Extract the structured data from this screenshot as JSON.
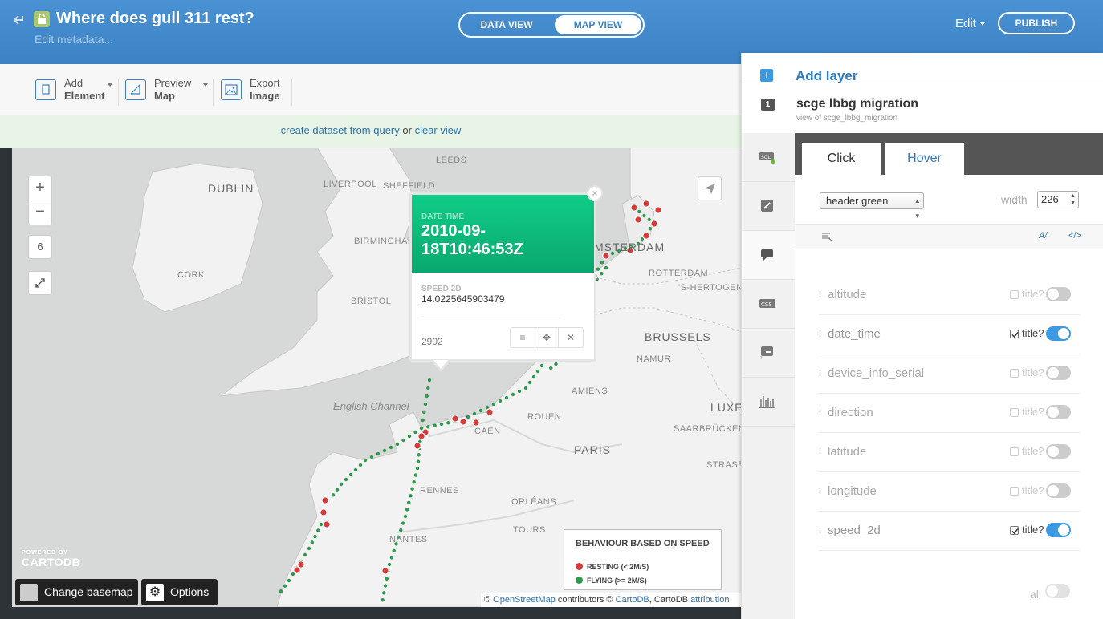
{
  "header": {
    "title": "Where does gull 311 rest?",
    "edit_metadata": "Edit metadata...",
    "view_toggle": {
      "data_view": "DATA VIEW",
      "map_view": "MAP VIEW",
      "active": "map_view"
    },
    "edit_menu": "Edit",
    "publish": "PUBLISH"
  },
  "toolbar": {
    "add_element": {
      "line1": "Add",
      "line2": "Element"
    },
    "preview_map": {
      "line1": "Preview",
      "line2": "Map"
    },
    "export_image": {
      "line1": "Export",
      "line2": "Image"
    }
  },
  "notice": {
    "link1": "create dataset from query",
    "middle": " or ",
    "link2": "clear view"
  },
  "map": {
    "zoom_level": "6",
    "zoom_in": "+",
    "zoom_out": "−",
    "cities": {
      "dublin": "DUBLIN",
      "leeds": "LEEDS",
      "liverpool": "LIVERPOOL",
      "sheffield": "SHEFFIELD",
      "birmingham": "BIRMINGHAM",
      "cork": "CORK",
      "bristol": "BRISTOL",
      "amsterdam": "MSTERDAM",
      "rotterdam": "ROTTERDAM",
      "hertogenbosch": "'S-HERTOGENBOSCH",
      "brussels": "BRUSSELS",
      "namur": "NAMUR",
      "amiens": "AMIENS",
      "luxembourg": "LUXE",
      "rouen": "ROUEN",
      "caen": "CAEN",
      "saarbrucken": "SAARBRÜCKEN",
      "paris": "PARIS",
      "rennes": "RENNES",
      "orleans": "ORLÉANS",
      "strasbourg": "STRASBO",
      "tours": "TOURS",
      "nantes": "NANTES"
    },
    "sea_label": "English Channel",
    "powered_by": "POWERED BY",
    "logo": "CARTODB",
    "change_basemap": "Change basemap",
    "options": "Options",
    "legend": {
      "title": "BEHAVIOUR BASED ON SPEED",
      "items": [
        {
          "label": "RESTING (< 2M/S)",
          "color": "#d43b3b"
        },
        {
          "label": "FLYING (>= 2M/S)",
          "color": "#2e9a4e"
        }
      ]
    },
    "attribution": {
      "c1": "© ",
      "osm": "OpenStreetMap",
      "c2": " contributors © ",
      "cartodb": "CartoDB",
      "c3": ", CartoDB ",
      "attr": "attribution"
    },
    "popup": {
      "date_label": "DATE TIME",
      "date_value": "2010-09-18T10:46:53Z",
      "speed_label": "SPEED 2D",
      "speed_value": "14.0225645903479",
      "id": "2902"
    }
  },
  "panel": {
    "add_layer": "Add layer",
    "layer_number": "1",
    "layer_name": "scge lbbg migration",
    "layer_sub": "view of scge_lbbg_migration",
    "side_icons": [
      "sql-icon",
      "wizard-icon",
      "infowindow-icon",
      "css-icon",
      "legend-icon",
      "chart-icon"
    ],
    "tabs": {
      "click": "Click",
      "hover": "Hover",
      "active": "click"
    },
    "template_select": "header green",
    "width_label": "width",
    "width_value": "226",
    "edit_text_icon": "A/",
    "code_icon": "</>",
    "title_label": "title?",
    "fields": [
      {
        "name": "altitude",
        "title_checked": false,
        "enabled": false
      },
      {
        "name": "date_time",
        "title_checked": true,
        "enabled": true
      },
      {
        "name": "device_info_serial",
        "title_checked": false,
        "enabled": false
      },
      {
        "name": "direction",
        "title_checked": false,
        "enabled": false
      },
      {
        "name": "latitude",
        "title_checked": false,
        "enabled": false
      },
      {
        "name": "longitude",
        "title_checked": false,
        "enabled": false
      },
      {
        "name": "speed_2d",
        "title_checked": true,
        "enabled": true
      }
    ],
    "all_label": "all"
  },
  "colors": {
    "header_blue": "#3b82c4",
    "popup_green": "#0fbd7e",
    "resting_red": "#d43b3b",
    "flying_green": "#2e9a4e",
    "toggle_on": "#3b9ae1"
  }
}
